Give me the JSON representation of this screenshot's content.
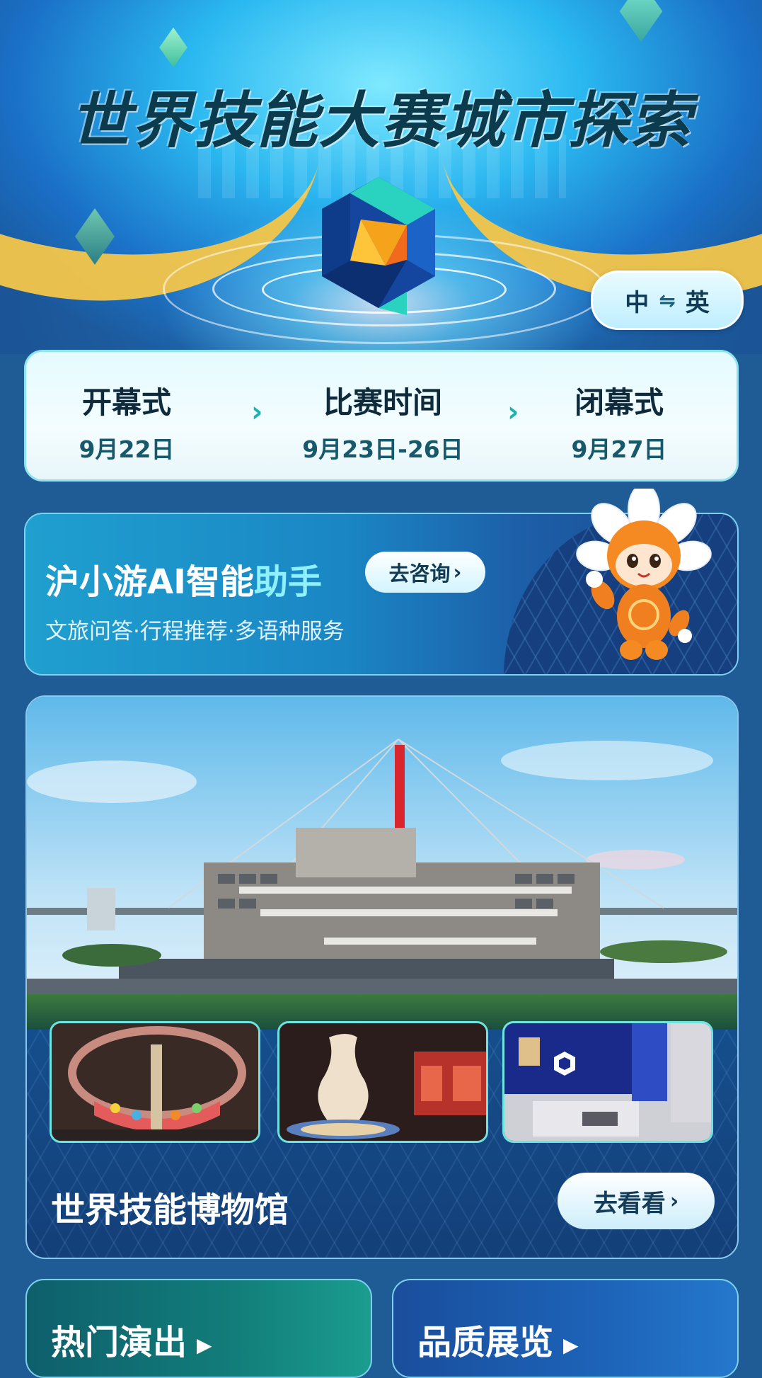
{
  "hero": {
    "title": "世界技能大赛城市探索",
    "lang_switch": {
      "left": "中",
      "swap": "⇋",
      "right": "英"
    }
  },
  "schedule": [
    {
      "label": "开幕式",
      "date": "9月22日"
    },
    {
      "label": "比赛时间",
      "date": "9月23日-26日"
    },
    {
      "label": "闭幕式",
      "date": "9月27日"
    }
  ],
  "schedule_arrow": "›",
  "ai_banner": {
    "title_main": "沪小游AI智能",
    "title_highlight": "助手",
    "button": "去咨询",
    "button_arrow": "›",
    "subtitle": "文旅问答·行程推荐·多语种服务"
  },
  "museum": {
    "title": "世界技能博物馆",
    "button": "去看看",
    "button_arrow": "›"
  },
  "bottom_cards": [
    {
      "title": "热门演出",
      "arrow": "▶"
    },
    {
      "title": "品质展览",
      "arrow": "▶"
    }
  ],
  "colors": {
    "page_bg": "#1f5b95",
    "accent_teal": "#19b3b0",
    "swoosh_gold": "#f4c64a",
    "title_dark": "#0b3b4c",
    "mascot_orange": "#f0801f"
  },
  "icons": [
    "swap-arrows-icon",
    "chevron-right-icon",
    "play-triangle-icon"
  ]
}
